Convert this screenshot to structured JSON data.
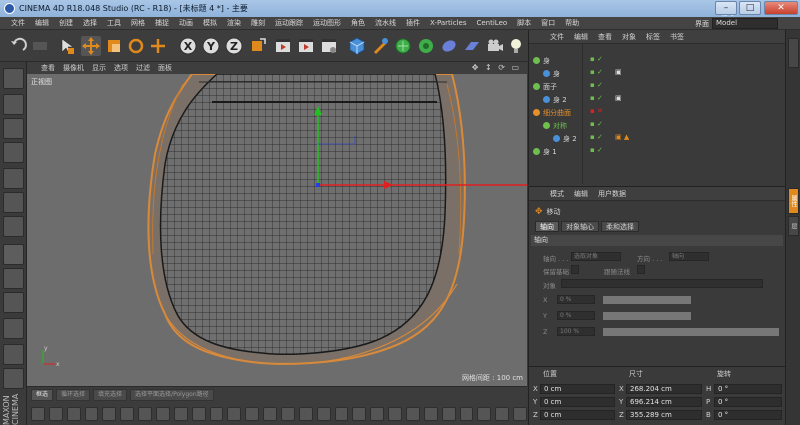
{
  "window": {
    "title": "CINEMA 4D R18.048 Studio (RC - R18) - [未标题 4 *] - 主要",
    "watermark": "模"
  },
  "menu": {
    "items": [
      "文件",
      "编辑",
      "创建",
      "选择",
      "工具",
      "网格",
      "捕捉",
      "动画",
      "模拟",
      "渲染",
      "雕刻",
      "运动跟踪",
      "运动图形",
      "角色",
      "流水线",
      "插件",
      "X-Particles",
      "CentiLeo",
      "脚本",
      "窗口",
      "帮助"
    ],
    "layout_label": "界面",
    "layout_value": "Model"
  },
  "viewport": {
    "menu": [
      "查看",
      "摄像机",
      "显示",
      "选项",
      "过滤",
      "面板"
    ],
    "label": "正视图",
    "grid_spacing": "网格间距 : 100 cm"
  },
  "bottom_toolbar": {
    "chips": [
      "框选",
      "循环选择",
      "填充选择",
      "选择平面选择/Polygon路径"
    ]
  },
  "object_manager": {
    "menu": [
      "文件",
      "编辑",
      "查看",
      "对象",
      "标签",
      "书签"
    ],
    "rows": [
      {
        "name": "身",
        "color": "#6fbf4f",
        "style": "normal",
        "indent": 0
      },
      {
        "name": "身",
        "color": "#6fbf4f",
        "style": "normal",
        "indent": 1
      },
      {
        "name": "面子",
        "color": "#6fbf4f",
        "style": "normal",
        "indent": 0
      },
      {
        "name": "身 2",
        "color": "#6fbf4f",
        "style": "normal",
        "indent": 1
      },
      {
        "name": "细分曲面",
        "color": "#e6902a",
        "style": "orange",
        "indent": 0
      },
      {
        "name": "对称",
        "color": "#6fbf4f",
        "style": "green",
        "indent": 1
      },
      {
        "name": "身 2",
        "color": "#6fbf4f",
        "style": "normal",
        "indent": 2
      },
      {
        "name": "身 1",
        "color": "#6fbf4f",
        "style": "normal",
        "indent": 0
      }
    ]
  },
  "attribute_manager": {
    "menu": [
      "模式",
      "编辑",
      "用户数据"
    ],
    "tool_name": "移动",
    "tabs": [
      "轴向",
      "对象轴心",
      "柔和选择"
    ],
    "section": "轴向",
    "fields": {
      "axis_label": "轴向 . . .",
      "axis_value": "选取对象",
      "dir_label": "方向 . . .",
      "dir_value": "轴向",
      "keep_label": "保留基础",
      "follow_label": "跟随法线",
      "object_label": "对象",
      "x_label": "X",
      "x_value": "0 %",
      "y_label": "Y",
      "y_value": "0 %",
      "z_label": "Z",
      "z_value": "100 %"
    }
  },
  "coordinates": {
    "headers": [
      "位置",
      "尺寸",
      "旋转"
    ],
    "rows": [
      {
        "axis": "X",
        "pos": "0 cm",
        "size": "268.204 cm",
        "rot_axis": "H",
        "rot": "0 °"
      },
      {
        "axis": "Y",
        "pos": "0 cm",
        "size": "696.214 cm",
        "rot_axis": "P",
        "rot": "0 °"
      },
      {
        "axis": "Z",
        "pos": "0 cm",
        "size": "355.289 cm",
        "rot_axis": "B",
        "rot": "0 °"
      }
    ]
  },
  "right_tabs": [
    "属性",
    "层"
  ],
  "colors": {
    "accent": "#e08a1e",
    "viewport_bg": "#6d6d6d",
    "mesh_line": "#1a1a1a",
    "mesh_edge": "#d88a3a",
    "axis_x": "#e02020",
    "axis_y": "#20c020",
    "axis_z": "#2040e0"
  }
}
